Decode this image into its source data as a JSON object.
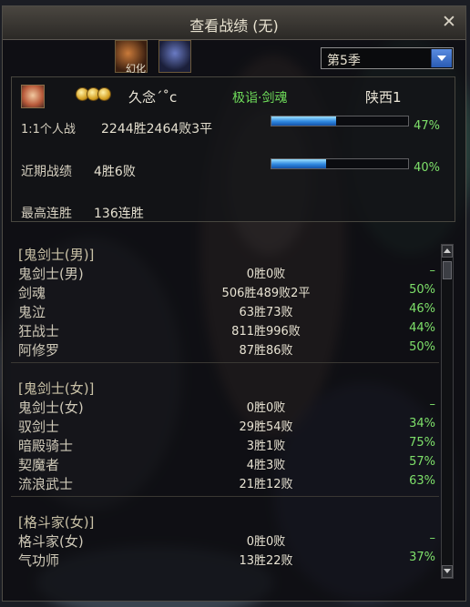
{
  "window": {
    "title": "查看战绩 (无)"
  },
  "decor": {
    "skill_label": "幻化"
  },
  "season": {
    "selected": "第5季"
  },
  "player": {
    "name": "久念ˊ˚c",
    "title": "极诣·剑魂",
    "server": "陕西1"
  },
  "stats": {
    "solo": {
      "label": "1:1个人战",
      "value": "2244胜2464败3平",
      "percent": "47%",
      "ratio": 0.47
    },
    "recent": {
      "label": "近期战绩",
      "value": "4胜6败",
      "percent": "40%",
      "ratio": 0.4
    },
    "best": {
      "label": "最高连胜",
      "value": "136连胜"
    }
  },
  "groups": [
    {
      "header": "[鬼剑士(男)]",
      "rows": [
        {
          "name": "鬼剑士(男)",
          "record": "0胜0败",
          "rate": "–"
        },
        {
          "name": "剑魂",
          "record": "506胜489败2平",
          "rate": "50%"
        },
        {
          "name": "鬼泣",
          "record": "63胜73败",
          "rate": "46%"
        },
        {
          "name": "狂战士",
          "record": "811胜996败",
          "rate": "44%"
        },
        {
          "name": "阿修罗",
          "record": "87胜86败",
          "rate": "50%"
        }
      ]
    },
    {
      "header": "[鬼剑士(女)]",
      "rows": [
        {
          "name": "鬼剑士(女)",
          "record": "0胜0败",
          "rate": "–"
        },
        {
          "name": "驭剑士",
          "record": "29胜54败",
          "rate": "34%"
        },
        {
          "name": "暗殿骑士",
          "record": "3胜1败",
          "rate": "75%"
        },
        {
          "name": "契魔者",
          "record": "4胜3败",
          "rate": "57%"
        },
        {
          "name": "流浪武士",
          "record": "21胜12败",
          "rate": "63%"
        }
      ]
    },
    {
      "header": "[格斗家(女)]",
      "rows": [
        {
          "name": "格斗家(女)",
          "record": "0胜0败",
          "rate": "–"
        },
        {
          "name": "气功师",
          "record": "13胜22败",
          "rate": "37%"
        }
      ]
    }
  ]
}
